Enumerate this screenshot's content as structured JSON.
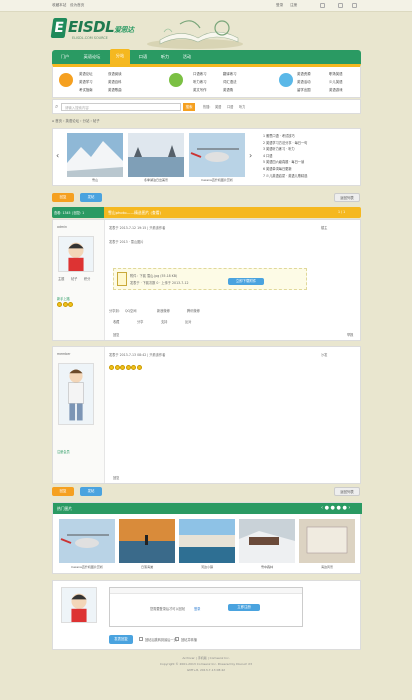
{
  "topbar": {
    "left_links": [
      "收藏本站",
      "设为首页"
    ],
    "right_links": [
      "登录",
      "注册"
    ]
  },
  "logo": {
    "name": "EISDL",
    "tag": "爱思达",
    "sub": "ELISDL.COM SOURCE"
  },
  "nav": {
    "items": [
      "门户",
      "英语论坛",
      "分站",
      "口语",
      "听力",
      "活动"
    ],
    "active_index": 2
  },
  "subnav": {
    "groups": [
      {
        "color": "#f5a020",
        "links": [
          "英语论坛",
          "英语学习",
          "考试指南",
          "双语阅读",
          "英语百科",
          "英语歌曲"
        ]
      },
      {
        "color": "#7bc043",
        "links": [
          "口语练习",
          "听力练习",
          "英文写作",
          "翻译练习",
          "词汇语法",
          "英语角"
        ]
      },
      {
        "color": "#5ab8e8",
        "links": [
          "英语资源",
          "英语活动",
          "留学出国",
          "职场英语",
          "少儿英语",
          "英语游戏"
        ]
      }
    ]
  },
  "search": {
    "placeholder": "请输入搜索内容",
    "button": "搜索",
    "hot_label": "热搜:",
    "hot_terms": [
      "英语",
      "口语",
      "听力"
    ]
  },
  "breadcrumb": [
    "首页",
    "英语论坛",
    "分站",
    "帖子"
  ],
  "carousel": {
    "captions": [
      "雪山",
      "冬季湖泊日出美景",
      "Cessna直升机图片赏析",
      "直升机"
    ],
    "news": [
      "1 雅思口语 · 考试技巧",
      "2 英语学习方法分享 · 每日一句",
      "3 英语听力练习 · 听力",
      "4 口语",
      "5 英语四六级真题 · 每日一读",
      "6 英语单词每日更新",
      "7 少儿英语启蒙 · 英语儿歌精选"
    ]
  },
  "actions": {
    "reply_button": "回复",
    "post_button": "发帖",
    "return_label": "返回列表"
  },
  "thread": {
    "header_label": "查看: 1345 | 回复: 1",
    "title": "雪山photo——精选图片 (查看)",
    "page": "1 / 1"
  },
  "post1": {
    "author": "admin",
    "meta": "发表于 2013-7-12 19:15 | 只看该作者",
    "floor_label": "楼主",
    "body_line": "发表于 2013 · 雪山图片",
    "attachment_title": "附件：下载 雪山.jpg (55.18 KB)",
    "attachment_text": "发表于 · 下载次数 0 · 上传于 2013-7-12",
    "buy_button": "立即下载附件",
    "share_label": "分享到:",
    "share_items": [
      "QQ空间",
      "新浪微博",
      "腾讯微博"
    ],
    "tool_items": [
      "收藏",
      "分享",
      "支持",
      "反对"
    ],
    "reply_label": "回复",
    "report_label": "举报",
    "stats": [
      "主题",
      "帖子",
      "积分"
    ],
    "badge": "新手上路"
  },
  "post2": {
    "author": "member",
    "meta": "发表于 2013-7-13 08:42 | 只看该作者",
    "floor_label": "沙发",
    "body_smiles": 6,
    "reply_label": "回复",
    "badge": "注册会员"
  },
  "quick": {
    "title": "热门图片",
    "captions": [
      "Cessna直升机图片赏析",
      "日落海滩",
      "河边小镇",
      "雪中森林",
      "海边风景"
    ]
  },
  "reply_box": {
    "prompt": "您需要登录后才可以回帖",
    "login": "登录",
    "register": "立即注册",
    "submit": "发表回复",
    "check1": "回帖后跳转到最后一页",
    "check2": "回帖并转播"
  },
  "footer": {
    "line1": "Archiver | 手机版 | Comsenz Inc.",
    "line2": "Copyright © 2001-2013 Comsenz Inc. Powered by Discuz! X3",
    "line3": "GMT+8, 2013-7-13 08:42"
  },
  "colors": {
    "green": "#2a9a63",
    "orange": "#f5b820",
    "blue": "#4aa3df"
  }
}
